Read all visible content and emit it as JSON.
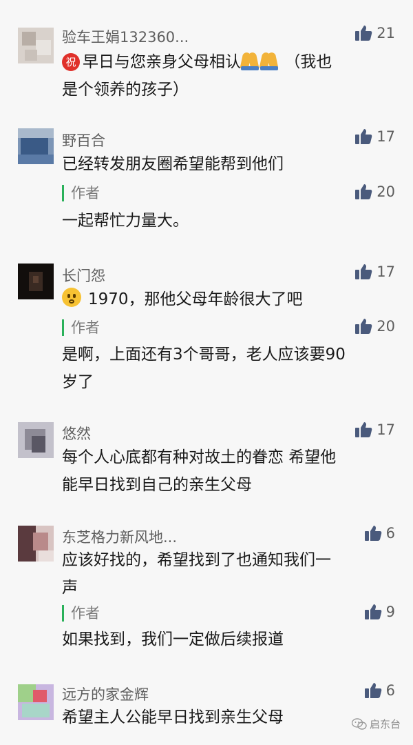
{
  "comments": [
    {
      "nickname": "验车王娟132360...",
      "likes": "21",
      "badge": "祝",
      "text1": "早日与您亲身父母相认",
      "text2": "（我也",
      "text3": "是个领养的孩子）",
      "avatar_colors": [
        "#d9d2cc",
        "#c9c1ba",
        "#e8e4e0"
      ]
    },
    {
      "nickname": "野百合",
      "likes": "17",
      "text1": "已经转发朋友圈希望能帮到他们",
      "reply_label": "作者",
      "reply_likes": "20",
      "reply_text": "一起帮忙力量大。",
      "avatar_colors": [
        "#3a5a86",
        "#7c95b6",
        "#a9b9cc"
      ]
    },
    {
      "nickname": "长门怨",
      "likes": "17",
      "text1": "1970，那他父母年龄很大了吧",
      "reply_label": "作者",
      "reply_likes": "20",
      "reply_text1": "是啊，上面还有3个哥哥，老人应该要90",
      "reply_text2": "岁了",
      "avatar_colors": [
        "#1a1412",
        "#3a2a22",
        "#120e0c"
      ]
    },
    {
      "nickname": "悠然",
      "likes": "17",
      "text1": "每个人心底都有种对故土的眷恋 希望他",
      "text2": "能早日找到自己的亲生父母",
      "avatar_colors": [
        "#8d8a96",
        "#c3c1cb",
        "#5a5764"
      ]
    },
    {
      "nickname": "东芝格力新风地...",
      "likes": "6",
      "text1": "应该好找的，希望找到了也通知我们一",
      "text2": "声",
      "reply_label": "作者",
      "reply_likes": "9",
      "reply_text": "如果找到，我们一定做后续报道",
      "avatar_colors": [
        "#b98a8a",
        "#5a3a3e",
        "#d8c4c2"
      ]
    },
    {
      "nickname": "远方的家金辉",
      "likes": "6",
      "text1": "希望主人公能早日找到亲生父母",
      "avatar_colors": [
        "#9fd08a",
        "#e05a6a",
        "#c8b6e0"
      ]
    }
  ],
  "watermark": "启东台",
  "colors": {
    "nickname": "#5e5e5e",
    "author_bar": "#2ab15a",
    "badge": "#e0302a"
  }
}
